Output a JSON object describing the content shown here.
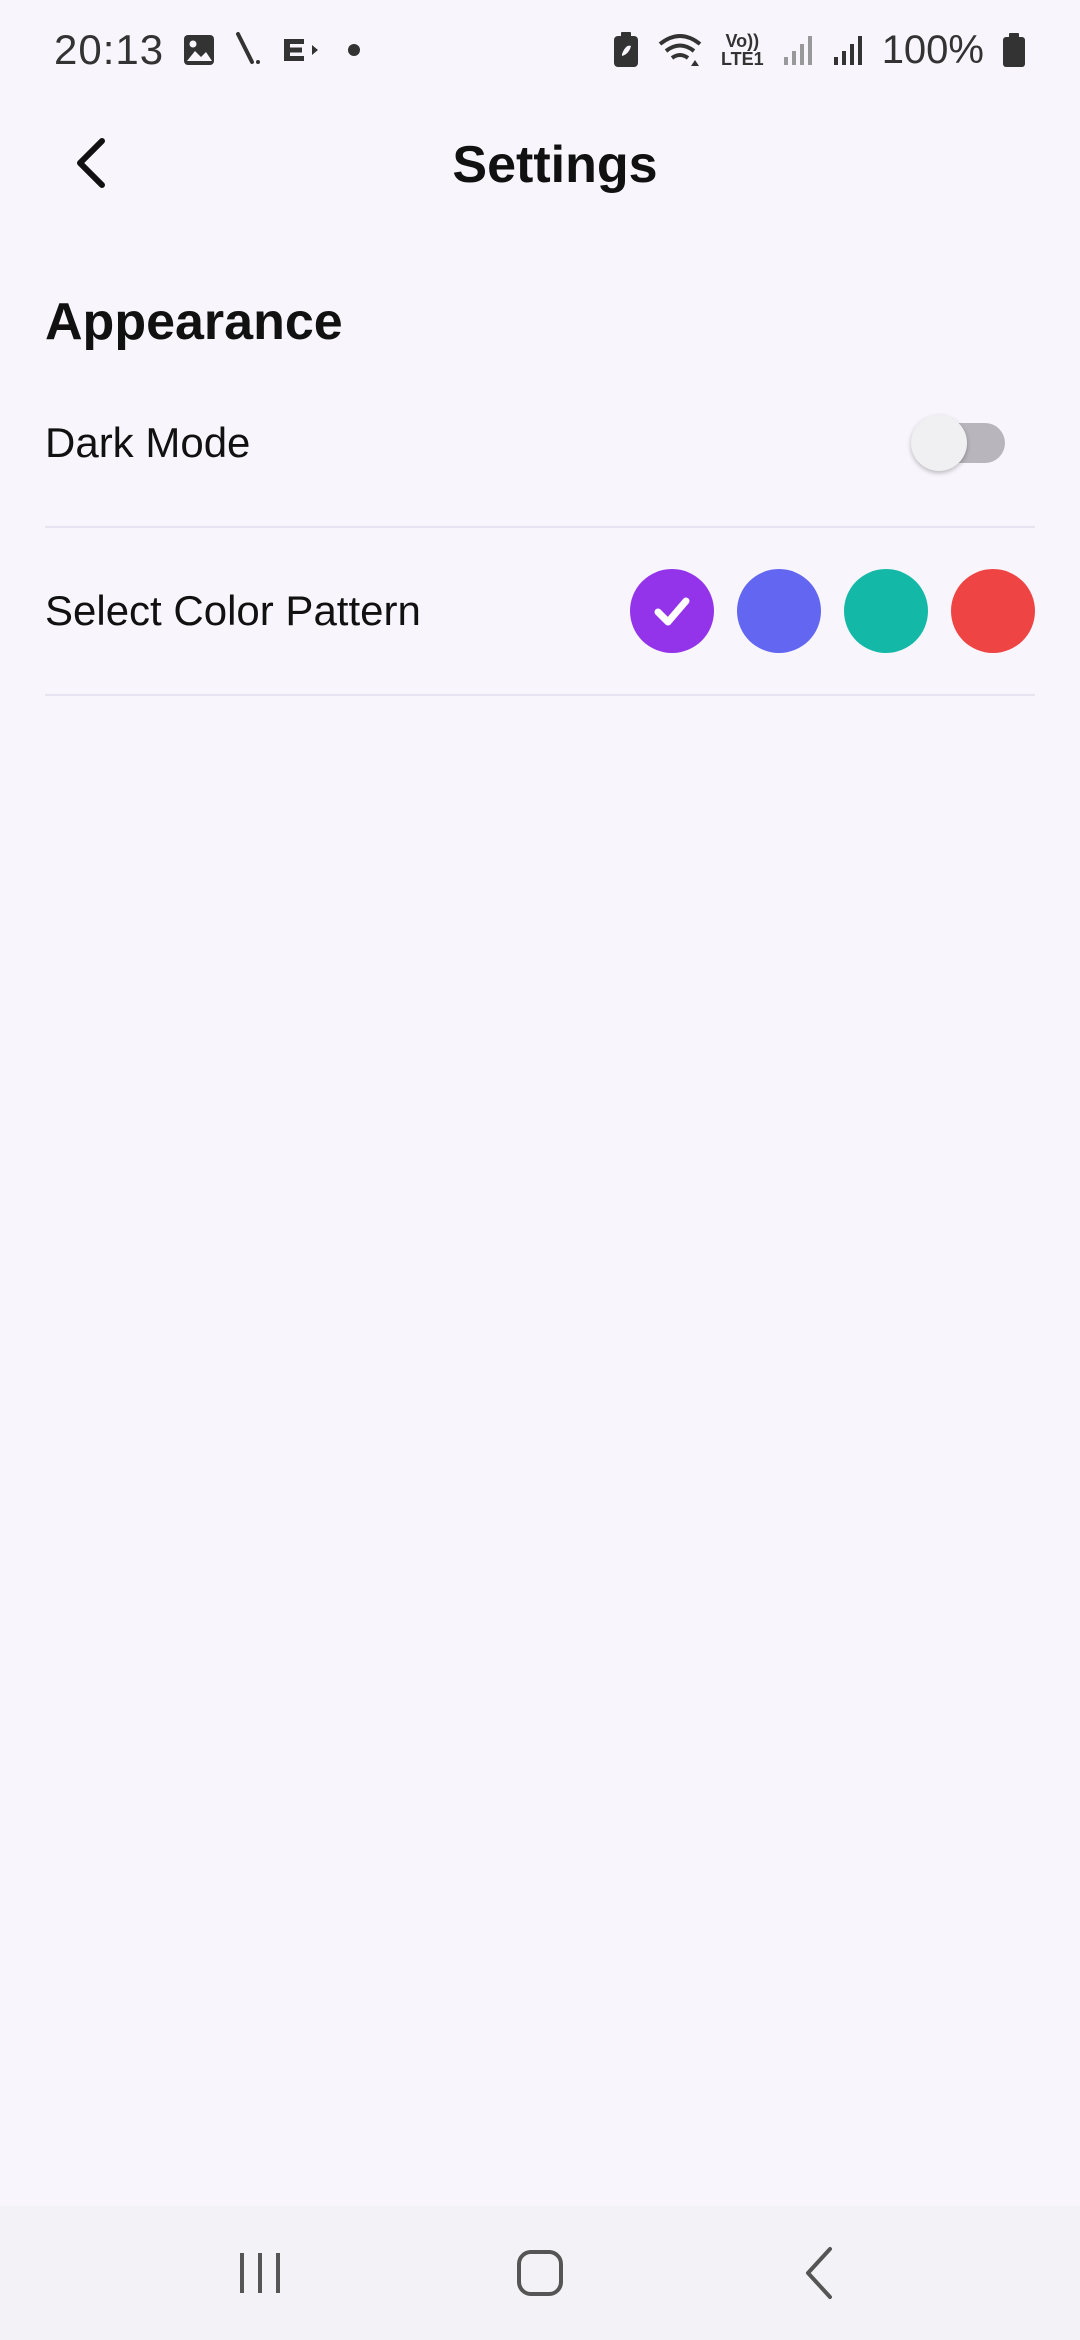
{
  "status_bar": {
    "time": "20:13",
    "left_icons": [
      "gallery-icon",
      "pen-icon",
      "media-icon",
      "dot-icon"
    ],
    "network_label_top": "Vo))",
    "network_label_bottom": "LTE1",
    "battery_percent": "100%"
  },
  "app_bar": {
    "title": "Settings",
    "back_icon": "chevron-left-icon"
  },
  "appearance": {
    "section_title": "Appearance",
    "dark_mode": {
      "label": "Dark Mode",
      "enabled": false
    },
    "color_pattern": {
      "label": "Select Color Pattern",
      "selected_index": 0,
      "colors": [
        "#9333ea",
        "#6366f1",
        "#14b8a6",
        "#ef4444"
      ]
    }
  },
  "nav_bar": {
    "buttons": [
      "recent-apps-icon",
      "home-icon",
      "back-icon"
    ]
  }
}
